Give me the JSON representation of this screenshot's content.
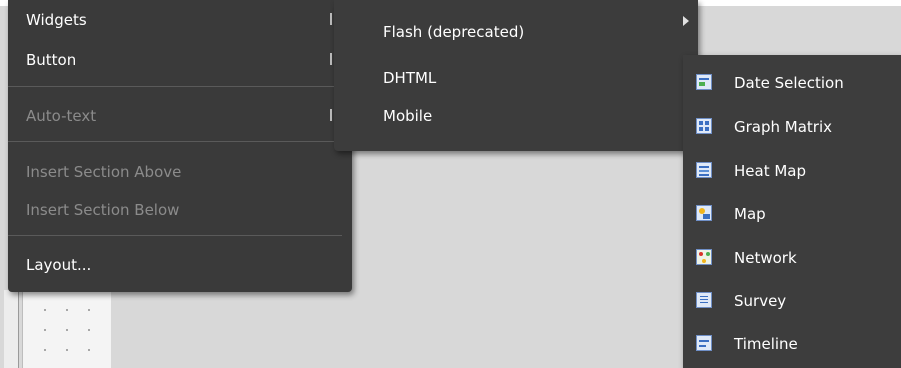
{
  "main_menu": {
    "items": [
      {
        "label": "Widgets"
      },
      {
        "label": "Button"
      },
      {
        "label": "Auto-text"
      },
      {
        "label": "Insert Section Above"
      },
      {
        "label": "Insert Section Below"
      },
      {
        "label": "Layout..."
      }
    ]
  },
  "widgets_submenu": {
    "items": [
      {
        "label": "Flash (deprecated)"
      },
      {
        "label": "DHTML"
      },
      {
        "label": "Mobile"
      }
    ]
  },
  "flash_submenu": {
    "items": [
      {
        "label": "Date Selection",
        "icon": "calendar-range-icon"
      },
      {
        "label": "Graph Matrix",
        "icon": "graph-matrix-icon"
      },
      {
        "label": "Heat Map",
        "icon": "heat-map-icon"
      },
      {
        "label": "Map",
        "icon": "map-icon"
      },
      {
        "label": "Network",
        "icon": "network-icon"
      },
      {
        "label": "Survey",
        "icon": "survey-icon"
      },
      {
        "label": "Timeline",
        "icon": "timeline-icon"
      }
    ]
  },
  "colors": {
    "menu_bg": "#3a3a3a",
    "menu_text": "#ffffff",
    "disabled_text": "#8b8b8b",
    "icon_accent": "#3b6fc2"
  }
}
